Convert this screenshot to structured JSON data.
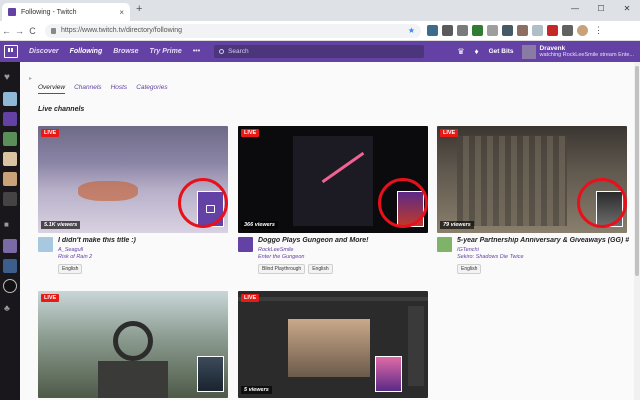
{
  "browser": {
    "tab_title": "Following - Twitch",
    "tab_close": "×",
    "new_tab": "+",
    "win_min": "—",
    "win_max": "☐",
    "win_close": "✕",
    "back": "←",
    "forward": "→",
    "reload": "C",
    "url": "https://www.twitch.tv/directory/following",
    "star": "★",
    "menu": "⋮"
  },
  "topnav": {
    "discover": "Discover",
    "following": "Following",
    "browse": "Browse",
    "try_prime": "Try Prime",
    "more": "•••",
    "search_placeholder": "Search",
    "crown": "♛",
    "bell": "♦",
    "get_bits": "Get Bits",
    "username": "Dravenk",
    "user_status": "watching RockLeeSmile stream Ente..."
  },
  "page": {
    "expand": "▸",
    "tabs": [
      "Overview",
      "Channels",
      "Hosts",
      "Categories"
    ],
    "section_title": "Live channels"
  },
  "channels": [
    {
      "live": "LIVE",
      "viewers": "5.1K viewers",
      "title": "I didn't make this title :)",
      "channel": "A_Seagull",
      "game": "Risk of Rain 2",
      "tags": [
        "English"
      ]
    },
    {
      "live": "LIVE",
      "viewers": "366 viewers",
      "title": "Doggo Plays Gungeon and More!",
      "channel": "RockLeeSmile",
      "game": "Enter the Gungeon",
      "tags": [
        "Blind Playthrough",
        "English"
      ]
    },
    {
      "live": "LIVE",
      "viewers": "79 viewers",
      "title": "5-year Partnership Anniversary & Giveaways (GG) #Gifte...",
      "channel": "IGTenchi",
      "game": "Sekiro: Shadows Die Twice",
      "tags": [
        "English"
      ]
    },
    {
      "live": "LIVE",
      "viewers": "",
      "title": "",
      "channel": "",
      "game": "",
      "tags": []
    },
    {
      "live": "LIVE",
      "viewers": "5 viewers",
      "title": "",
      "channel": "",
      "game": "",
      "tags": []
    }
  ],
  "colors": {
    "twitch_purple": "#6441a4",
    "live_red": "#e91916",
    "annotation_red": "#e8101a"
  }
}
